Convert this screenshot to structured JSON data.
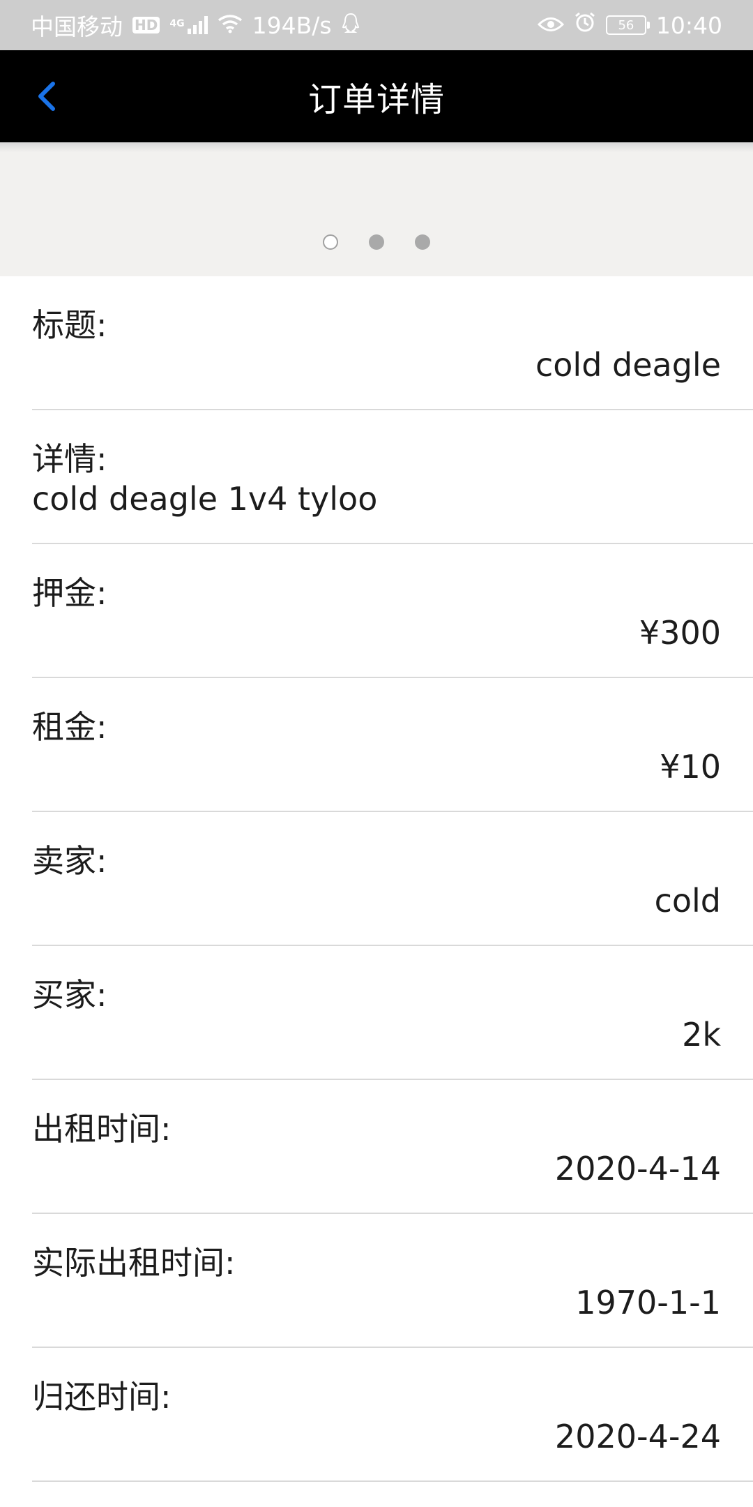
{
  "status_bar": {
    "carrier": "中国移动",
    "hd": "HD",
    "network": "4G",
    "speed": "194B/s",
    "battery": "56",
    "time": "10:40"
  },
  "header": {
    "title": "订单详情"
  },
  "banner": {
    "page_count": 3,
    "active_index": 0
  },
  "details": [
    {
      "label": "标题:",
      "value": "cold deagle",
      "align": "right"
    },
    {
      "label": "详情:",
      "value": "cold deagle 1v4 tyloo",
      "align": "left"
    },
    {
      "label": "押金:",
      "value": "¥300",
      "align": "right"
    },
    {
      "label": "租金:",
      "value": "¥10",
      "align": "right"
    },
    {
      "label": "卖家:",
      "value": "cold",
      "align": "right"
    },
    {
      "label": "买家:",
      "value": "2k",
      "align": "right"
    },
    {
      "label": "出租时间:",
      "value": "2020-4-14",
      "align": "right"
    },
    {
      "label": "实际出租时间:",
      "value": "1970-1-1",
      "align": "right"
    },
    {
      "label": "归还时间:",
      "value": "2020-4-24",
      "align": "right"
    }
  ],
  "colors": {
    "accent": "#1a73e8",
    "title_bar": "#000000",
    "status_bar": "#cdcdcd"
  }
}
